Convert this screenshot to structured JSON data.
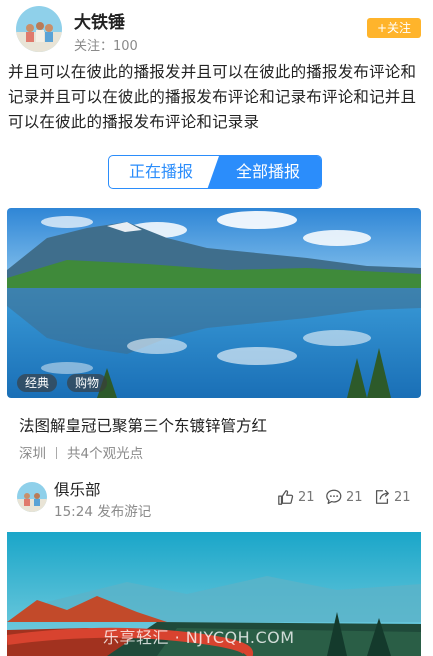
{
  "header": {
    "username": "大铁锤",
    "follow_count": "关注：100",
    "follow_button": "+关注"
  },
  "post": {
    "text": "并且可以在彼此的播报发并且可以在彼此的播报发布评论和记录并且可以在彼此的播报发布评论和记录布评论和记并且可以在彼此的播报发布评论和记录录"
  },
  "tabs": {
    "items": [
      "正在播报",
      "全部播报"
    ],
    "active_index": 1
  },
  "card": {
    "tags": [
      "经典",
      "购物"
    ],
    "title": "法图解皇冠已聚第三个东镀锌管方红",
    "location": "深圳",
    "spots": "共4个观光点"
  },
  "club": {
    "name": "俱乐部",
    "time": "15:24 发布游记",
    "likes": "21",
    "comments": "21",
    "shares": "21"
  },
  "watermark": "乐享轻汇 · NJYCQH.COM",
  "colors": {
    "accent": "#2b8dfb",
    "follow": "#ffb42b",
    "muted": "#8a8a8a"
  }
}
